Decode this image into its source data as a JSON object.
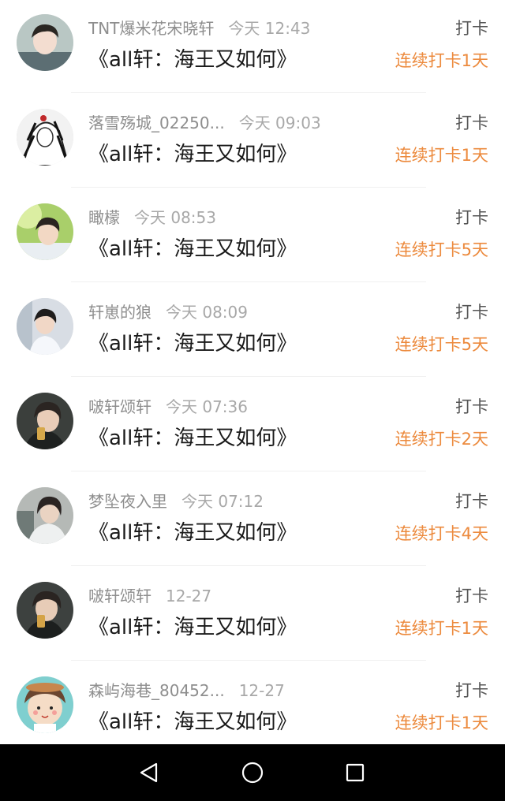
{
  "feed": [
    {
      "name": "TNT爆米花宋晓轩",
      "time": "今天 12:43",
      "title": "《all轩：海王又如何》",
      "action": "打卡",
      "streak": "连续打卡1天",
      "avatar_icon": "person-photo-icon"
    },
    {
      "name": "落雪殇城_02250...",
      "time": "今天 09:03",
      "title": "《all轩：海王又如何》",
      "action": "打卡",
      "streak": "连续打卡1天",
      "avatar_icon": "anime-sketch-icon"
    },
    {
      "name": "瞰檬",
      "time": "今天 08:53",
      "title": "《all轩：海王又如何》",
      "action": "打卡",
      "streak": "连续打卡5天",
      "avatar_icon": "person-photo-icon"
    },
    {
      "name": "轩崽的狼",
      "time": "今天 08:09",
      "title": "《all轩：海王又如何》",
      "action": "打卡",
      "streak": "连续打卡5天",
      "avatar_icon": "person-photo-icon"
    },
    {
      "name": "啵轩颂轩",
      "time": "今天 07:36",
      "title": "《all轩：海王又如何》",
      "action": "打卡",
      "streak": "连续打卡2天",
      "avatar_icon": "person-photo-icon"
    },
    {
      "name": "梦坠夜入里",
      "time": "今天 07:12",
      "title": "《all轩：海王又如何》",
      "action": "打卡",
      "streak": "连续打卡4天",
      "avatar_icon": "person-photo-icon"
    },
    {
      "name": "啵轩颂轩",
      "time": "12-27",
      "title": "《all轩：海王又如何》",
      "action": "打卡",
      "streak": "连续打卡1天",
      "avatar_icon": "person-photo-icon"
    },
    {
      "name": "森屿海巷_80452...",
      "time": "12-27",
      "title": "《all轩：海王又如何》",
      "action": "打卡",
      "streak": "连续打卡1天",
      "avatar_icon": "cartoon-girl-icon"
    }
  ],
  "navbar": {
    "back_icon": "back-triangle-icon",
    "home_icon": "home-circle-icon",
    "recents_icon": "recents-square-icon"
  },
  "colors": {
    "streak": "#ec8a3d",
    "name": "#8e8e8e",
    "title": "#1a1a1a",
    "navbar": "#000000"
  }
}
